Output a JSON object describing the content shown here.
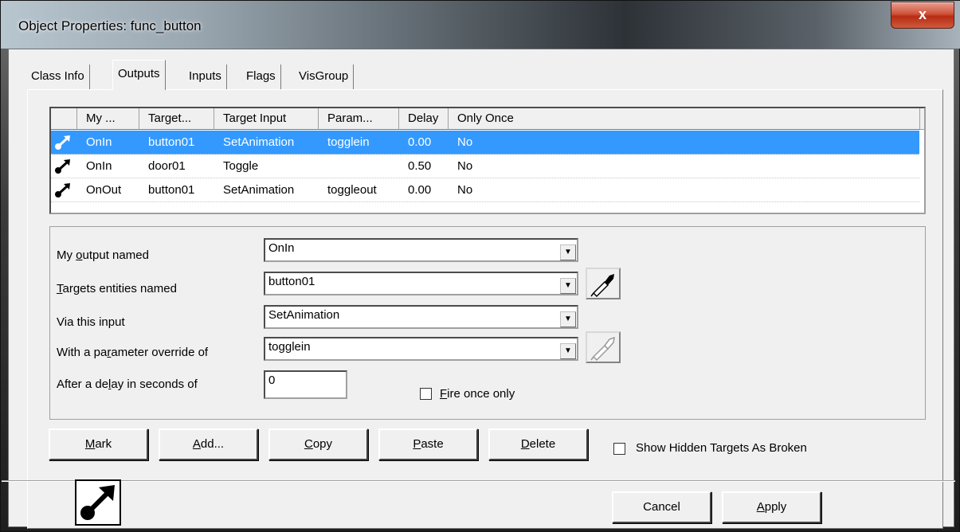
{
  "window": {
    "title": "Object Properties: func_button",
    "close_glyph": "x"
  },
  "tabs": [
    {
      "label": "Class Info"
    },
    {
      "label": "Outputs"
    },
    {
      "label": "Inputs"
    },
    {
      "label": "Flags"
    },
    {
      "label": "VisGroup"
    }
  ],
  "list": {
    "columns": [
      "My ...",
      "Target...",
      "Target Input",
      "Param...",
      "Delay",
      "Only Once"
    ],
    "rows": [
      {
        "output": "OnIn",
        "target": "button01",
        "input": "SetAnimation",
        "param": "togglein",
        "delay": "0.00",
        "once": "No"
      },
      {
        "output": "OnIn",
        "target": "door01",
        "input": "Toggle",
        "param": "",
        "delay": "0.50",
        "once": "No"
      },
      {
        "output": "OnOut",
        "target": "button01",
        "input": "SetAnimation",
        "param": "toggleout",
        "delay": "0.00",
        "once": "No"
      }
    ]
  },
  "form": {
    "output_label_pre": "My ",
    "output_label_u": "o",
    "output_label_post": "utput named",
    "output_value": "OnIn",
    "targets_label_u": "T",
    "targets_label_post": "argets entities named",
    "targets_value": "button01",
    "input_label": "Via this input",
    "input_value": "SetAnimation",
    "param_label_pre": "With a pa",
    "param_label_u": "r",
    "param_label_post": "ameter override of",
    "param_value": "togglein",
    "delay_label_pre": "After a de",
    "delay_label_u": "l",
    "delay_label_post": "ay in seconds of",
    "delay_value": "0",
    "fire_once_u": "F",
    "fire_once_post": "ire once only"
  },
  "buttons": {
    "mark_u": "M",
    "mark_post": "ark",
    "add_u": "A",
    "add_post": "dd...",
    "copy_u": "C",
    "copy_post": "opy",
    "paste_u": "P",
    "paste_post": "aste",
    "delete_u": "D",
    "delete_post": "elete",
    "show_hidden": "Show Hidden Targets As Broken",
    "cancel": "Cancel",
    "apply_u": "A",
    "apply_post": "pply"
  },
  "colors": {
    "selection": "#3399ff",
    "dialog_bg": "#f0f0f0"
  },
  "icons": {
    "row_icon": "output-connection-icon",
    "eyedropper": "eyedropper-icon"
  }
}
